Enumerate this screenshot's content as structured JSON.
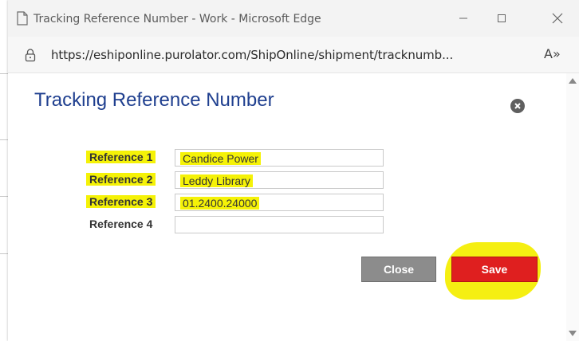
{
  "window": {
    "title": "Tracking Reference Number - Work - Microsoft Edge",
    "url": "https://eshiponline.purolator.com/ShipOnline/shipment/tracknumb...",
    "read_aloud_label": "A»"
  },
  "dialog": {
    "title": "Tracking Reference Number",
    "fields": [
      {
        "label": "Reference 1",
        "value": "Candice Power",
        "highlighted": true
      },
      {
        "label": "Reference 2",
        "value": "Leddy Library",
        "highlighted": true
      },
      {
        "label": "Reference 3",
        "value": "01.2400.24000",
        "highlighted": true
      },
      {
        "label": "Reference 4",
        "value": "",
        "highlighted": false
      }
    ],
    "buttons": {
      "close": "Close",
      "save": "Save"
    }
  },
  "colors": {
    "title": "#1f3f8f",
    "highlight": "#f5f207",
    "save_button": "#df1f1f",
    "close_button": "#8c8c8c"
  }
}
